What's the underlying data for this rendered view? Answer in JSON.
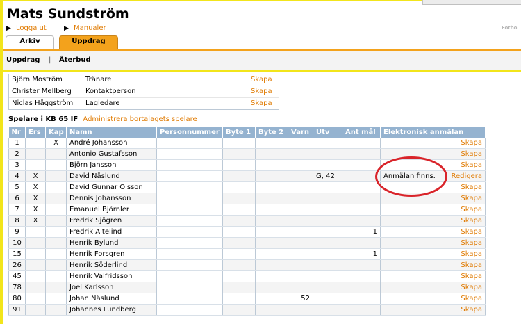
{
  "brand": "Fotbo",
  "user": {
    "name": "Mats Sundström"
  },
  "top_links": [
    {
      "label": "Logga ut"
    },
    {
      "label": "Manualer"
    }
  ],
  "tabs": [
    {
      "label": "Arkiv"
    },
    {
      "label": "Uppdrag"
    }
  ],
  "subnav": {
    "items": [
      {
        "label": "Uppdrag"
      },
      {
        "label": "Återbud"
      }
    ],
    "separator": "|"
  },
  "staff": [
    {
      "name": "Björn Moström",
      "role": "Tränare",
      "action": "Skapa"
    },
    {
      "name": "Christer Mellberg",
      "role": "Kontaktperson",
      "action": "Skapa"
    },
    {
      "name": "Niclas Häggström",
      "role": "Lagledare",
      "action": "Skapa"
    }
  ],
  "section": {
    "title": "Spelare i KB 65 IF",
    "link": "Administrera bortalagets spelare"
  },
  "table": {
    "headers": [
      "Nr",
      "Ers",
      "Kap",
      "Namn",
      "Personnummer",
      "Byte 1",
      "Byte 2",
      "Varn",
      "Utv",
      "Ant mål",
      "Elektronisk anmälan"
    ],
    "rows": [
      {
        "nr": "1",
        "ers": "",
        "kap": "X",
        "name": "André Johansson",
        "varn": "",
        "utv": "",
        "goals": "",
        "action": "Skapa"
      },
      {
        "nr": "2",
        "ers": "",
        "kap": "",
        "name": "Antonio Gustafsson",
        "varn": "",
        "utv": "",
        "goals": "",
        "action": "Skapa"
      },
      {
        "nr": "3",
        "ers": "",
        "kap": "",
        "name": "Björn Jansson",
        "varn": "",
        "utv": "",
        "goals": "",
        "action": "Skapa"
      },
      {
        "nr": "4",
        "ers": "X",
        "kap": "",
        "name": "David Näslund",
        "varn": "",
        "utv": "G, 42",
        "goals": "",
        "action": "Redigera",
        "message": "Anmälan finns."
      },
      {
        "nr": "5",
        "ers": "X",
        "kap": "",
        "name": "David Gunnar Olsson",
        "varn": "",
        "utv": "",
        "goals": "",
        "action": "Skapa"
      },
      {
        "nr": "6",
        "ers": "X",
        "kap": "",
        "name": "Dennis Johansson",
        "varn": "",
        "utv": "",
        "goals": "",
        "action": "Skapa"
      },
      {
        "nr": "7",
        "ers": "X",
        "kap": "",
        "name": "Emanuel Björnler",
        "varn": "",
        "utv": "",
        "goals": "",
        "action": "Skapa"
      },
      {
        "nr": "8",
        "ers": "X",
        "kap": "",
        "name": "Fredrik Sjögren",
        "varn": "",
        "utv": "",
        "goals": "",
        "action": "Skapa"
      },
      {
        "nr": "9",
        "ers": "",
        "kap": "",
        "name": "Fredrik Altelind",
        "varn": "",
        "utv": "",
        "goals": "1",
        "action": "Skapa"
      },
      {
        "nr": "10",
        "ers": "",
        "kap": "",
        "name": "Henrik Bylund",
        "varn": "",
        "utv": "",
        "goals": "",
        "action": "Skapa"
      },
      {
        "nr": "15",
        "ers": "",
        "kap": "",
        "name": "Henrik Forsgren",
        "varn": "",
        "utv": "",
        "goals": "1",
        "action": "Skapa"
      },
      {
        "nr": "26",
        "ers": "",
        "kap": "",
        "name": "Henrik Söderlind",
        "varn": "",
        "utv": "",
        "goals": "",
        "action": "Skapa"
      },
      {
        "nr": "45",
        "ers": "",
        "kap": "",
        "name": "Henrik Valfridsson",
        "varn": "",
        "utv": "",
        "goals": "",
        "action": "Skapa"
      },
      {
        "nr": "78",
        "ers": "",
        "kap": "",
        "name": "Joel Karlsson",
        "varn": "",
        "utv": "",
        "goals": "",
        "action": "Skapa"
      },
      {
        "nr": "80",
        "ers": "",
        "kap": "",
        "name": "Johan Näslund",
        "varn": "52",
        "utv": "",
        "goals": "",
        "action": "Skapa"
      },
      {
        "nr": "91",
        "ers": "",
        "kap": "",
        "name": "Johannes Lundberg",
        "varn": "",
        "utv": "",
        "goals": "",
        "action": "Skapa"
      }
    ]
  },
  "colors": {
    "accent": "#f3a21c",
    "link": "#e07a00",
    "header": "#95b3d0",
    "highlight_circle": "#d9242a",
    "side_bar": "#f2e51b"
  }
}
